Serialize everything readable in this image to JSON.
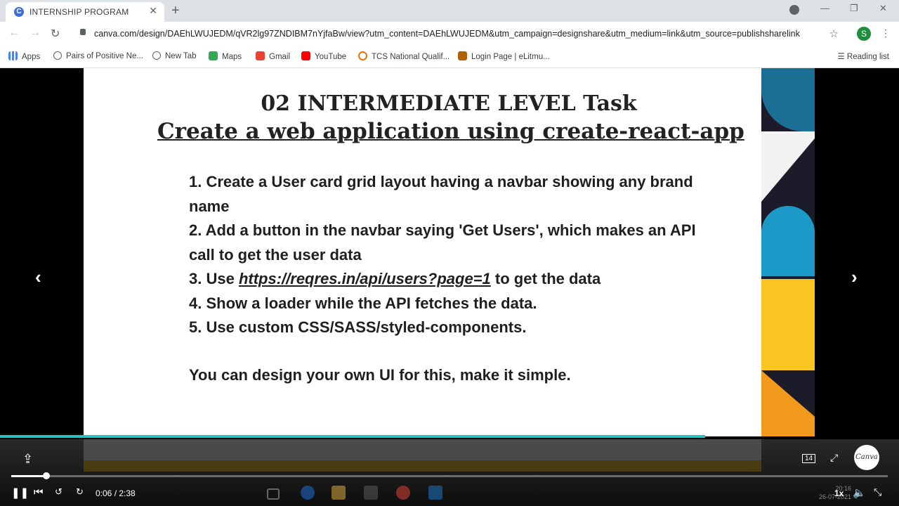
{
  "browser": {
    "tab_title": "INTERNSHIP PROGRAM",
    "tab_favicon_letter": "C",
    "url": "canva.com/design/DAEhLWUJEDM/qVR2lg97ZNDIBM7nYjfaBw/view?utm_content=DAEhLWUJEDM&utm_campaign=designshare&utm_medium=link&utm_source=publishsharelink",
    "profile_initial": "S",
    "bookmarks": [
      {
        "label": "Apps",
        "color": "#5f6368"
      },
      {
        "label": "Pairs of Positive Ne...",
        "color": "#5f6368"
      },
      {
        "label": "New Tab",
        "color": "#5f6368"
      },
      {
        "label": "Maps",
        "color": "#34a853"
      },
      {
        "label": "Gmail",
        "color": "#ea4335"
      },
      {
        "label": "YouTube",
        "color": "#ff0000"
      },
      {
        "label": "TCS National Qualif...",
        "color": "#e8710a"
      },
      {
        "label": "Login Page | eLitmu...",
        "color": "#b06000"
      }
    ],
    "reading_list": "Reading list"
  },
  "slide": {
    "title_line1": "02 INTERMEDIATE LEVEL Task",
    "title_line2": " Create a web application using create-react-app ",
    "items": [
      {
        "text": "1. Create a User card grid layout having a navbar showing any brand name"
      },
      {
        "text": "2. Add a button in the navbar saying 'Get Users', which makes an API call to get the user data"
      },
      {
        "pre": "3. Use ",
        "link": "https://reqres.in/api/users?page=1",
        "post": " to get the data"
      },
      {
        "text": "4. Show a loader while the API fetches the data."
      },
      {
        "text": "5. Use custom CSS/SASS/styled-components."
      }
    ],
    "note": "You can design your own UI for this, make it simple."
  },
  "player": {
    "time": "0:06 / 2:38",
    "progress_fraction": 0.04,
    "speed": "1x",
    "page_badge": "14",
    "logo": "Canva"
  },
  "taskbar": {
    "clock_time": "20:16",
    "clock_date": "26-07-2021"
  },
  "colors": {
    "accent_cyan": "#2bbfc2",
    "strip_yellow": "#f9c520",
    "strip_orange": "#f29a1c",
    "strip_navy": "#0f1c3a",
    "strip_teal": "#1c9ac7"
  }
}
